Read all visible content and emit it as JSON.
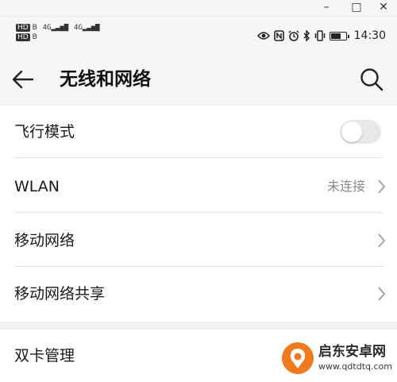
{
  "window": {
    "minimize": "–",
    "maximize": "□",
    "close": "✕"
  },
  "status_bar": {
    "sim1_label": "HD",
    "sim1_sub": "B",
    "sim2_label": "HD",
    "sim2_sub": "B",
    "net1": "4G",
    "net2": "4G",
    "icons": [
      "eye-icon",
      "nfc-icon",
      "alarm-icon",
      "bluetooth-icon",
      "vibrate-icon",
      "battery-icon"
    ],
    "battery_level": 0.6,
    "time": "14:30"
  },
  "header": {
    "title": "无线和网络"
  },
  "settings": {
    "airplane": {
      "label": "飞行模式",
      "enabled": false
    },
    "wlan": {
      "label": "WLAN",
      "value": "未连接"
    },
    "mobile_network": {
      "label": "移动网络"
    },
    "tethering": {
      "label": "移动网络共享"
    },
    "dual_sim": {
      "label": "双卡管理"
    }
  },
  "watermark": {
    "name": "启东安卓网",
    "url": "www.qdtdtq.com"
  },
  "colors": {
    "background": "#f1f1f1",
    "card": "#ffffff",
    "secondary_text": "#8a8a8a",
    "watermark_orange": "#f07a1e"
  }
}
